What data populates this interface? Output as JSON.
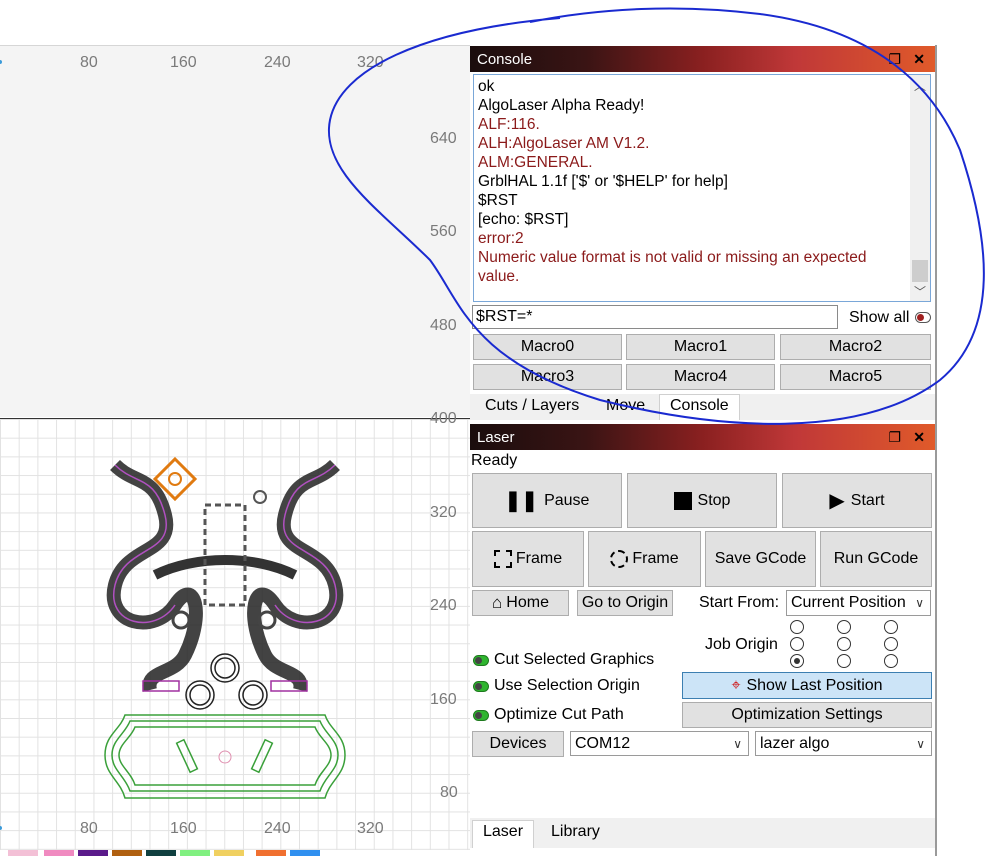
{
  "rulers": {
    "top": [
      "80",
      "160",
      "240",
      "320"
    ],
    "bottom": [
      "80",
      "160",
      "240",
      "320"
    ],
    "left_upper": [
      "640",
      "560",
      "480"
    ],
    "left_lower": [
      "400",
      "320",
      "240",
      "160",
      "80"
    ]
  },
  "palette_colors": [
    "#f3c0d6",
    "#f08ac0",
    "#5a1a8a",
    "#b06010",
    "#104040",
    "#80f080",
    "#f0d060",
    "#f07030",
    "#3090f0"
  ],
  "console": {
    "title": "Console",
    "lines": [
      {
        "text": "ok",
        "error": false
      },
      {
        "text": "AlgoLaser Alpha Ready!",
        "error": false
      },
      {
        "text": "ALF:116.",
        "error": true
      },
      {
        "text": "ALH:AlgoLaser AM V1.2.",
        "error": true
      },
      {
        "text": "ALM:GENERAL.",
        "error": true
      },
      {
        "text": "GrblHAL 1.1f ['$' or '$HELP' for help]",
        "error": false
      },
      {
        "text": "$RST",
        "error": false
      },
      {
        "text": "[echo: $RST]",
        "error": false
      },
      {
        "text": "error:2",
        "error": true
      },
      {
        "text": "Numeric value format is not valid or missing an expected value.",
        "error": true
      }
    ],
    "input_value": "$RST=*",
    "show_all_label": "Show all",
    "macros": [
      "Macro0",
      "Macro1",
      "Macro2",
      "Macro3",
      "Macro4",
      "Macro5"
    ],
    "tabs": [
      "Cuts / Layers",
      "Move",
      "Console"
    ],
    "active_tab": "Console"
  },
  "laser": {
    "title": "Laser",
    "status": "Ready",
    "pause_label": "Pause",
    "stop_label": "Stop",
    "start_label": "Start",
    "frame_rect_label": "Frame",
    "frame_circle_label": "Frame",
    "save_gcode_label": "Save GCode",
    "run_gcode_label": "Run GCode",
    "home_label": "Home",
    "go_to_origin_label": "Go to Origin",
    "start_from_label": "Start From:",
    "start_from_value": "Current Position",
    "job_origin_label": "Job Origin",
    "job_origin_selected": "bottom-left",
    "cut_selected_label": "Cut Selected Graphics",
    "use_selection_origin_label": "Use Selection Origin",
    "optimize_cut_path_label": "Optimize Cut Path",
    "show_last_position_label": "Show Last Position",
    "optimization_settings_label": "Optimization Settings",
    "devices_label": "Devices",
    "port_value": "COM12",
    "device_value": "lazer algo",
    "tabs": [
      "Laser",
      "Library"
    ],
    "active_tab": "Laser"
  },
  "annotation_color": "#1a2ad0"
}
